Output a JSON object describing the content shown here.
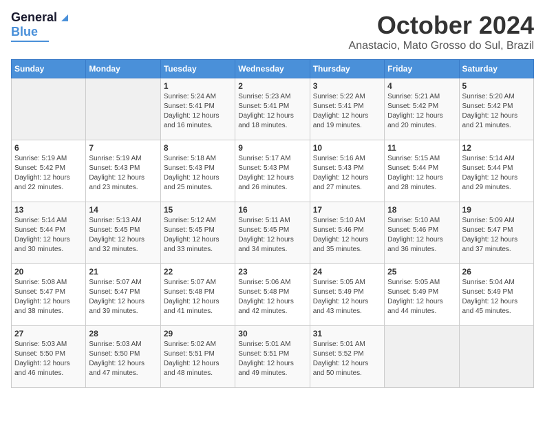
{
  "header": {
    "logo_general": "General",
    "logo_blue": "Blue",
    "month_title": "October 2024",
    "location": "Anastacio, Mato Grosso do Sul, Brazil"
  },
  "calendar": {
    "days_of_week": [
      "Sunday",
      "Monday",
      "Tuesday",
      "Wednesday",
      "Thursday",
      "Friday",
      "Saturday"
    ],
    "weeks": [
      [
        {
          "day": "",
          "sunrise": "",
          "sunset": "",
          "daylight": ""
        },
        {
          "day": "",
          "sunrise": "",
          "sunset": "",
          "daylight": ""
        },
        {
          "day": "1",
          "sunrise": "Sunrise: 5:24 AM",
          "sunset": "Sunset: 5:41 PM",
          "daylight": "Daylight: 12 hours and 16 minutes."
        },
        {
          "day": "2",
          "sunrise": "Sunrise: 5:23 AM",
          "sunset": "Sunset: 5:41 PM",
          "daylight": "Daylight: 12 hours and 18 minutes."
        },
        {
          "day": "3",
          "sunrise": "Sunrise: 5:22 AM",
          "sunset": "Sunset: 5:41 PM",
          "daylight": "Daylight: 12 hours and 19 minutes."
        },
        {
          "day": "4",
          "sunrise": "Sunrise: 5:21 AM",
          "sunset": "Sunset: 5:42 PM",
          "daylight": "Daylight: 12 hours and 20 minutes."
        },
        {
          "day": "5",
          "sunrise": "Sunrise: 5:20 AM",
          "sunset": "Sunset: 5:42 PM",
          "daylight": "Daylight: 12 hours and 21 minutes."
        }
      ],
      [
        {
          "day": "6",
          "sunrise": "Sunrise: 5:19 AM",
          "sunset": "Sunset: 5:42 PM",
          "daylight": "Daylight: 12 hours and 22 minutes."
        },
        {
          "day": "7",
          "sunrise": "Sunrise: 5:19 AM",
          "sunset": "Sunset: 5:43 PM",
          "daylight": "Daylight: 12 hours and 23 minutes."
        },
        {
          "day": "8",
          "sunrise": "Sunrise: 5:18 AM",
          "sunset": "Sunset: 5:43 PM",
          "daylight": "Daylight: 12 hours and 25 minutes."
        },
        {
          "day": "9",
          "sunrise": "Sunrise: 5:17 AM",
          "sunset": "Sunset: 5:43 PM",
          "daylight": "Daylight: 12 hours and 26 minutes."
        },
        {
          "day": "10",
          "sunrise": "Sunrise: 5:16 AM",
          "sunset": "Sunset: 5:43 PM",
          "daylight": "Daylight: 12 hours and 27 minutes."
        },
        {
          "day": "11",
          "sunrise": "Sunrise: 5:15 AM",
          "sunset": "Sunset: 5:44 PM",
          "daylight": "Daylight: 12 hours and 28 minutes."
        },
        {
          "day": "12",
          "sunrise": "Sunrise: 5:14 AM",
          "sunset": "Sunset: 5:44 PM",
          "daylight": "Daylight: 12 hours and 29 minutes."
        }
      ],
      [
        {
          "day": "13",
          "sunrise": "Sunrise: 5:14 AM",
          "sunset": "Sunset: 5:44 PM",
          "daylight": "Daylight: 12 hours and 30 minutes."
        },
        {
          "day": "14",
          "sunrise": "Sunrise: 5:13 AM",
          "sunset": "Sunset: 5:45 PM",
          "daylight": "Daylight: 12 hours and 32 minutes."
        },
        {
          "day": "15",
          "sunrise": "Sunrise: 5:12 AM",
          "sunset": "Sunset: 5:45 PM",
          "daylight": "Daylight: 12 hours and 33 minutes."
        },
        {
          "day": "16",
          "sunrise": "Sunrise: 5:11 AM",
          "sunset": "Sunset: 5:45 PM",
          "daylight": "Daylight: 12 hours and 34 minutes."
        },
        {
          "day": "17",
          "sunrise": "Sunrise: 5:10 AM",
          "sunset": "Sunset: 5:46 PM",
          "daylight": "Daylight: 12 hours and 35 minutes."
        },
        {
          "day": "18",
          "sunrise": "Sunrise: 5:10 AM",
          "sunset": "Sunset: 5:46 PM",
          "daylight": "Daylight: 12 hours and 36 minutes."
        },
        {
          "day": "19",
          "sunrise": "Sunrise: 5:09 AM",
          "sunset": "Sunset: 5:47 PM",
          "daylight": "Daylight: 12 hours and 37 minutes."
        }
      ],
      [
        {
          "day": "20",
          "sunrise": "Sunrise: 5:08 AM",
          "sunset": "Sunset: 5:47 PM",
          "daylight": "Daylight: 12 hours and 38 minutes."
        },
        {
          "day": "21",
          "sunrise": "Sunrise: 5:07 AM",
          "sunset": "Sunset: 5:47 PM",
          "daylight": "Daylight: 12 hours and 39 minutes."
        },
        {
          "day": "22",
          "sunrise": "Sunrise: 5:07 AM",
          "sunset": "Sunset: 5:48 PM",
          "daylight": "Daylight: 12 hours and 41 minutes."
        },
        {
          "day": "23",
          "sunrise": "Sunrise: 5:06 AM",
          "sunset": "Sunset: 5:48 PM",
          "daylight": "Daylight: 12 hours and 42 minutes."
        },
        {
          "day": "24",
          "sunrise": "Sunrise: 5:05 AM",
          "sunset": "Sunset: 5:49 PM",
          "daylight": "Daylight: 12 hours and 43 minutes."
        },
        {
          "day": "25",
          "sunrise": "Sunrise: 5:05 AM",
          "sunset": "Sunset: 5:49 PM",
          "daylight": "Daylight: 12 hours and 44 minutes."
        },
        {
          "day": "26",
          "sunrise": "Sunrise: 5:04 AM",
          "sunset": "Sunset: 5:49 PM",
          "daylight": "Daylight: 12 hours and 45 minutes."
        }
      ],
      [
        {
          "day": "27",
          "sunrise": "Sunrise: 5:03 AM",
          "sunset": "Sunset: 5:50 PM",
          "daylight": "Daylight: 12 hours and 46 minutes."
        },
        {
          "day": "28",
          "sunrise": "Sunrise: 5:03 AM",
          "sunset": "Sunset: 5:50 PM",
          "daylight": "Daylight: 12 hours and 47 minutes."
        },
        {
          "day": "29",
          "sunrise": "Sunrise: 5:02 AM",
          "sunset": "Sunset: 5:51 PM",
          "daylight": "Daylight: 12 hours and 48 minutes."
        },
        {
          "day": "30",
          "sunrise": "Sunrise: 5:01 AM",
          "sunset": "Sunset: 5:51 PM",
          "daylight": "Daylight: 12 hours and 49 minutes."
        },
        {
          "day": "31",
          "sunrise": "Sunrise: 5:01 AM",
          "sunset": "Sunset: 5:52 PM",
          "daylight": "Daylight: 12 hours and 50 minutes."
        },
        {
          "day": "",
          "sunrise": "",
          "sunset": "",
          "daylight": ""
        },
        {
          "day": "",
          "sunrise": "",
          "sunset": "",
          "daylight": ""
        }
      ]
    ]
  }
}
